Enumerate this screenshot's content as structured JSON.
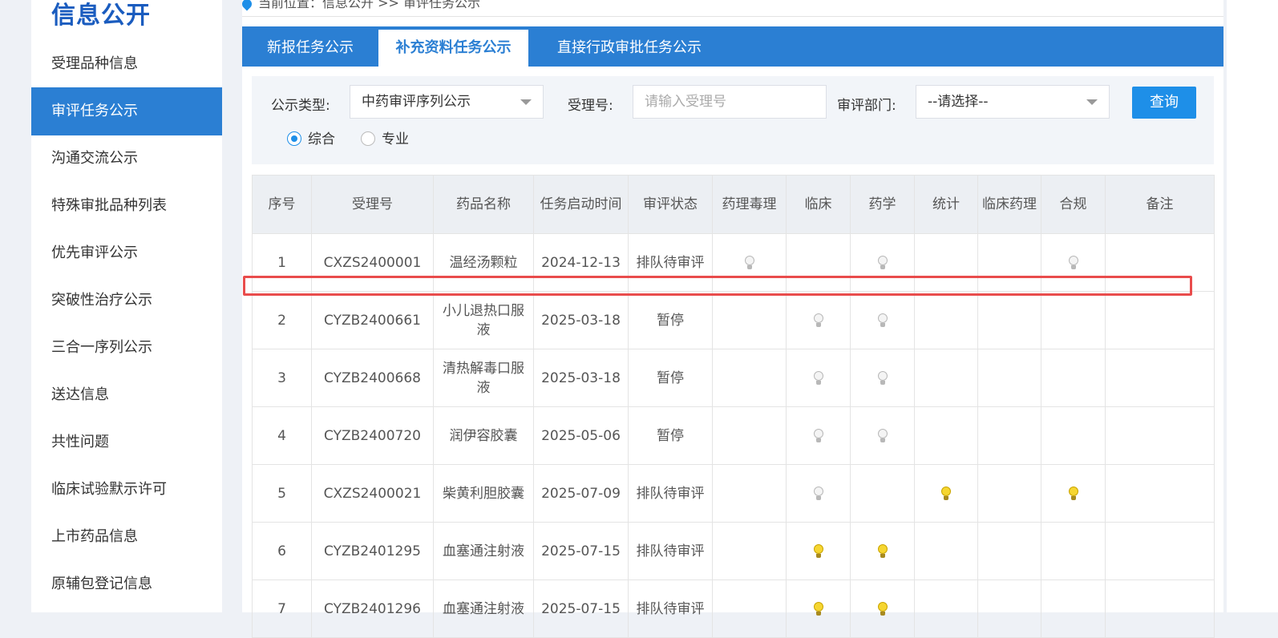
{
  "sidebar": {
    "title": "信息公开",
    "items": [
      {
        "label": "受理品种信息",
        "active": false
      },
      {
        "label": "审评任务公示",
        "active": true
      },
      {
        "label": "沟通交流公示",
        "active": false
      },
      {
        "label": "特殊审批品种列表",
        "active": false
      },
      {
        "label": "优先审评公示",
        "active": false
      },
      {
        "label": "突破性治疗公示",
        "active": false
      },
      {
        "label": "三合一序列公示",
        "active": false
      },
      {
        "label": "送达信息",
        "active": false
      },
      {
        "label": "共性问题",
        "active": false
      },
      {
        "label": "临床试验默示许可",
        "active": false
      },
      {
        "label": "上市药品信息",
        "active": false
      },
      {
        "label": "原辅包登记信息",
        "active": false
      }
    ]
  },
  "breadcrumb": {
    "text": "当前位置：信息公开 >> 审评任务公示"
  },
  "tabs": [
    {
      "label": "新报任务公示",
      "active": false
    },
    {
      "label": "补充资料任务公示",
      "active": true
    },
    {
      "label": "直接行政审批任务公示",
      "active": false
    }
  ],
  "filter": {
    "type_label": "公示类型:",
    "type_value": "中药审评序列公示",
    "acceptance_label": "受理号:",
    "acceptance_placeholder": "请输入受理号",
    "dept_label": "审评部门:",
    "dept_value": "--请选择--",
    "query_button": "查询",
    "radio_general": "综合",
    "radio_professional": "专业"
  },
  "table": {
    "columns": [
      "序号",
      "受理号",
      "药品名称",
      "任务启动时间",
      "审评状态",
      "药理毒理",
      "临床",
      "药学",
      "统计",
      "临床药理",
      "合规",
      "备注"
    ],
    "rows": [
      {
        "no": "1",
        "id": "CXZS2400001",
        "name": "温经汤颗粒",
        "date": "2024-12-13",
        "status": "排队待审评",
        "bulbs": {
          "pharm_tox": "off",
          "clinical": "",
          "pharmacy": "off",
          "stats": "",
          "clin_pharm": "",
          "compliance": "off"
        }
      },
      {
        "no": "2",
        "id": "CYZB2400661",
        "name": "小儿退热口服液",
        "date": "2025-03-18",
        "status": "暂停",
        "bulbs": {
          "pharm_tox": "",
          "clinical": "off",
          "pharmacy": "off",
          "stats": "",
          "clin_pharm": "",
          "compliance": ""
        }
      },
      {
        "no": "3",
        "id": "CYZB2400668",
        "name": "清热解毒口服液",
        "date": "2025-03-18",
        "status": "暂停",
        "bulbs": {
          "pharm_tox": "",
          "clinical": "off",
          "pharmacy": "off",
          "stats": "",
          "clin_pharm": "",
          "compliance": ""
        }
      },
      {
        "no": "4",
        "id": "CYZB2400720",
        "name": "润伊容胶囊",
        "date": "2025-05-06",
        "status": "暂停",
        "bulbs": {
          "pharm_tox": "",
          "clinical": "off",
          "pharmacy": "off",
          "stats": "",
          "clin_pharm": "",
          "compliance": ""
        }
      },
      {
        "no": "5",
        "id": "CXZS2400021",
        "name": "柴黄利胆胶囊",
        "date": "2025-07-09",
        "status": "排队待审评",
        "bulbs": {
          "pharm_tox": "",
          "clinical": "off",
          "pharmacy": "",
          "stats": "on",
          "clin_pharm": "",
          "compliance": "on"
        }
      },
      {
        "no": "6",
        "id": "CYZB2401295",
        "name": "血塞通注射液",
        "date": "2025-07-15",
        "status": "排队待审评",
        "bulbs": {
          "pharm_tox": "",
          "clinical": "on",
          "pharmacy": "on",
          "stats": "",
          "clin_pharm": "",
          "compliance": ""
        }
      },
      {
        "no": "7",
        "id": "CYZB2401296",
        "name": "血塞通注射液",
        "date": "2025-07-15",
        "status": "排队待审评",
        "bulbs": {
          "pharm_tox": "",
          "clinical": "on",
          "pharmacy": "on",
          "stats": "",
          "clin_pharm": "",
          "compliance": ""
        }
      }
    ]
  }
}
